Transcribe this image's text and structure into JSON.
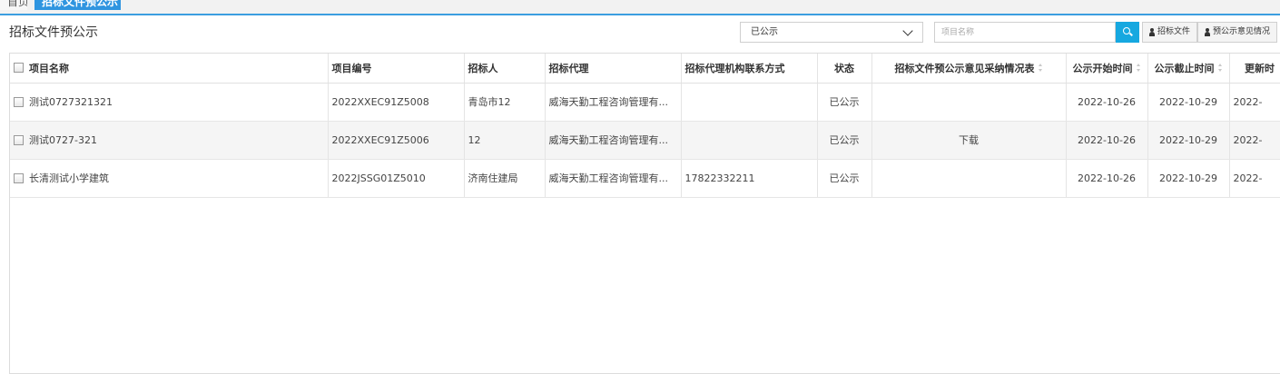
{
  "tabs": {
    "home_label": "首页",
    "active_label": "招标文件预公示"
  },
  "toolbar": {
    "page_title": "招标文件预公示",
    "status_select": {
      "selected": "已公示"
    },
    "search": {
      "placeholder": "项目名称",
      "value": ""
    },
    "buttons": {
      "tender_file": "招标文件",
      "opinion_status": "预公示意见情况"
    }
  },
  "table": {
    "headers": {
      "name": "项目名称",
      "code": "项目编号",
      "tenderer": "招标人",
      "agent": "招标代理",
      "agent_contact": "招标代理机构联系方式",
      "status": "状态",
      "opinion_form": "招标文件预公示意见采纳情况表",
      "start_date": "公示开始时间",
      "end_date": "公示截止时间",
      "updated": "更新时"
    },
    "rows": [
      {
        "name": "测试0727321321",
        "code": "2022XXEC91Z5008",
        "tenderer": "青岛市12",
        "agent": "威海天勤工程咨询管理有...",
        "agent_contact": "",
        "status": "已公示",
        "opinion_form": "",
        "start_date": "2022-10-26",
        "end_date": "2022-10-29",
        "updated": "2022-"
      },
      {
        "name": "测试0727-321",
        "code": "2022XXEC91Z5006",
        "tenderer": "12",
        "agent": "威海天勤工程咨询管理有...",
        "agent_contact": "",
        "status": "已公示",
        "opinion_form": "下载",
        "start_date": "2022-10-26",
        "end_date": "2022-10-29",
        "updated": "2022-"
      },
      {
        "name": "长清测试小学建筑",
        "code": "2022JSSG01Z5010",
        "tenderer": "济南住建局",
        "agent": "威海天勤工程咨询管理有...",
        "agent_contact": "17822332211",
        "status": "已公示",
        "opinion_form": "",
        "start_date": "2022-10-26",
        "end_date": "2022-10-29",
        "updated": "2022-"
      }
    ]
  },
  "colors": {
    "accent": "#2f95e0",
    "search_button": "#16a8e0",
    "alt_row": "#f5f5f5"
  }
}
